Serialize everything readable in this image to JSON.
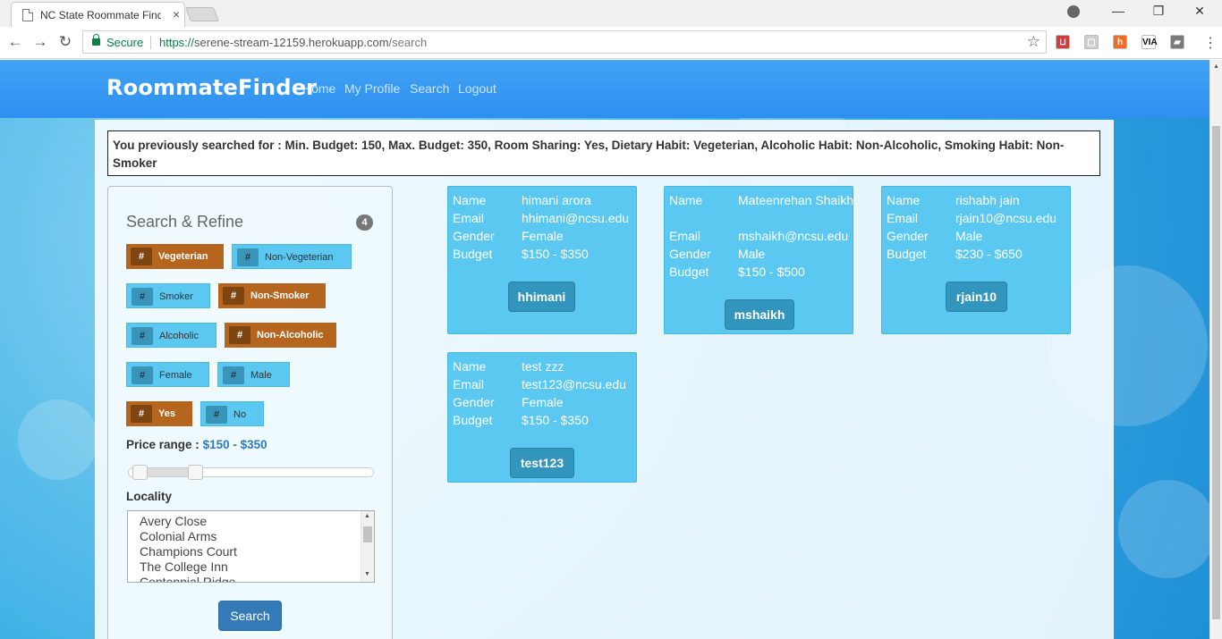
{
  "browser": {
    "tab_title": "NC State Roommate Finder",
    "tab_close": "×",
    "secure_label": "Secure",
    "url_scheme": "https://",
    "url_host": "serene-stream-12159.herokuapp.com",
    "url_path": "/search",
    "window_controls": {
      "minimize": "—",
      "restore": "❐",
      "close": "✕"
    },
    "back": "←",
    "forward": "→",
    "reload": "↻",
    "star": "☆",
    "menu": "⋮",
    "extensions": [
      {
        "name": "pocket-extension-icon",
        "glyph": "⊔",
        "color": "#d03d3d"
      },
      {
        "name": "disabled-extension-icon",
        "glyph": "▢",
        "color": "#cfcfcf"
      },
      {
        "name": "honey-extension-icon",
        "glyph": "h",
        "color": "#f26c21"
      },
      {
        "name": "via-extension-icon",
        "glyph": "VIA",
        "color": "#ffffff"
      },
      {
        "name": "grey-extension-icon",
        "glyph": "▰",
        "color": "#7a7a7a"
      }
    ]
  },
  "nav": {
    "brand": "RoommateFinder",
    "links": [
      "Home",
      "My Profile",
      "Search",
      "Logout"
    ]
  },
  "previous_search": "You previously searched for : Min. Budget: 150, Max. Budget: 350, Room Sharing: Yes, Dietary Habit: Vegeterian, Alcoholic Habit: Non-Alcoholic, Smoking Habit: Non-Smoker",
  "refine": {
    "title": "Search & Refine",
    "count": "4",
    "hash": "#",
    "tags": [
      {
        "label": "Vegeterian",
        "active": true
      },
      {
        "label": "Non-Vegeterian",
        "active": false
      },
      {
        "label": "Smoker",
        "active": false
      },
      {
        "label": "Non-Smoker",
        "active": true
      },
      {
        "label": "Alcoholic",
        "active": false
      },
      {
        "label": "Non-Alcoholic",
        "active": true
      },
      {
        "label": "Female",
        "active": false
      },
      {
        "label": "Male",
        "active": false
      },
      {
        "label": "Yes",
        "active": true
      },
      {
        "label": "No",
        "active": false
      }
    ],
    "price_label": "Price range :",
    "price_value": "$150 - $350",
    "locality_label": "Locality",
    "localities": [
      "Avery Close",
      "Colonial Arms",
      "Champions Court",
      "The College Inn",
      "Centennial Ridge"
    ],
    "search_button": "Search"
  },
  "results": [
    {
      "name": "himani arora",
      "email": "hhimani@ncsu.edu",
      "gender": "Female",
      "budget": "$150 - $350",
      "username": "hhimani"
    },
    {
      "name": "Mateenrehan Shaikh",
      "email": "mshaikh@ncsu.edu",
      "gender": "Male",
      "budget": "$150 - $500",
      "username": "mshaikh"
    },
    {
      "name": "rishabh jain",
      "email": "rjain10@ncsu.edu",
      "gender": "Male",
      "budget": "$230 - $650",
      "username": "rjain10"
    },
    {
      "name": "test zzz",
      "email": "test123@ncsu.edu",
      "gender": "Female",
      "budget": "$150 - $350",
      "username": "test123"
    }
  ],
  "card_labels": {
    "name": "Name",
    "email": "Email",
    "gender": "Gender",
    "budget": "Budget"
  },
  "scroll_arrows": {
    "up": "▲",
    "down": "▼"
  }
}
